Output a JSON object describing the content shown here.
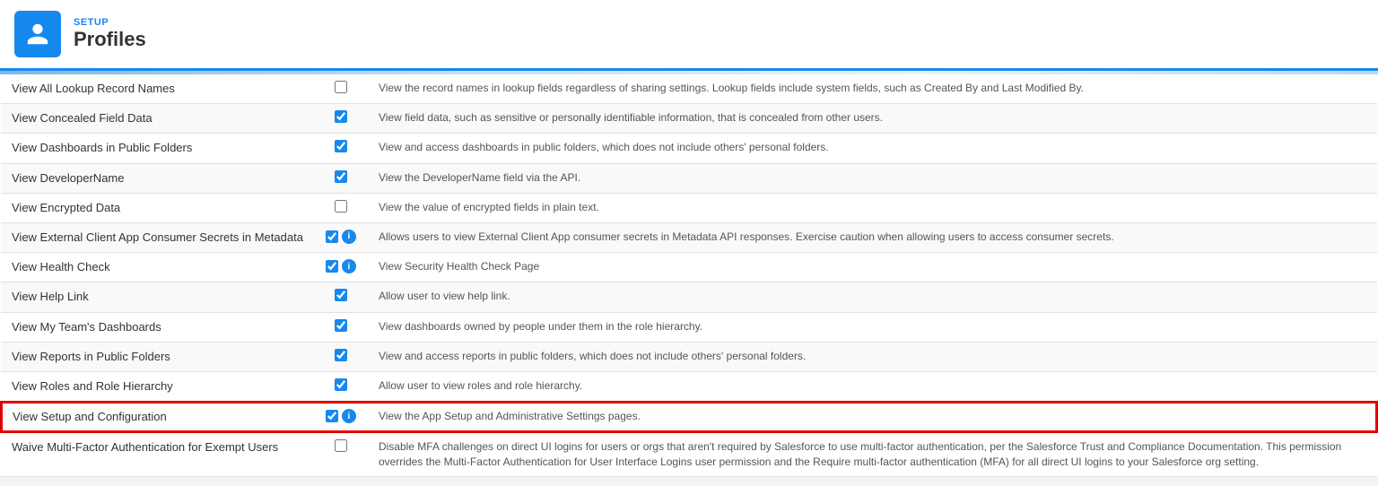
{
  "header": {
    "setup_label": "SETUP",
    "page_title": "Profiles"
  },
  "table": {
    "rows": [
      {
        "name": "View All Lookup Record Names",
        "checked": false,
        "has_info": false,
        "description": "View the record names in lookup fields regardless of sharing settings. Lookup fields include system fields, such as Created By and Last Modified By."
      },
      {
        "name": "View Concealed Field Data",
        "checked": true,
        "has_info": false,
        "description": "View field data, such as sensitive or personally identifiable information, that is concealed from other users."
      },
      {
        "name": "View Dashboards in Public Folders",
        "checked": true,
        "has_info": false,
        "description": "View and access dashboards in public folders, which does not include others' personal folders."
      },
      {
        "name": "View DeveloperName",
        "checked": true,
        "has_info": false,
        "description": "View the DeveloperName field via the API."
      },
      {
        "name": "View Encrypted Data",
        "checked": false,
        "has_info": false,
        "description": "View the value of encrypted fields in plain text."
      },
      {
        "name": "View External Client App Consumer Secrets in Metadata",
        "checked": true,
        "has_info": true,
        "description": "Allows users to view External Client App consumer secrets in Metadata API responses. Exercise caution when allowing users to access consumer secrets."
      },
      {
        "name": "View Health Check",
        "checked": true,
        "has_info": true,
        "description": "View Security Health Check Page"
      },
      {
        "name": "View Help Link",
        "checked": true,
        "has_info": false,
        "description": "Allow user to view help link."
      },
      {
        "name": "View My Team's Dashboards",
        "checked": true,
        "has_info": false,
        "description": "View dashboards owned by people under them in the role hierarchy."
      },
      {
        "name": "View Reports in Public Folders",
        "checked": true,
        "has_info": false,
        "description": "View and access reports in public folders, which does not include others' personal folders."
      },
      {
        "name": "View Roles and Role Hierarchy",
        "checked": true,
        "has_info": false,
        "description": "Allow user to view roles and role hierarchy."
      },
      {
        "name": "View Setup and Configuration",
        "checked": true,
        "has_info": true,
        "description": "View the App Setup and Administrative Settings pages.",
        "highlighted": true
      },
      {
        "name": "Waive Multi-Factor Authentication for Exempt Users",
        "checked": false,
        "has_info": false,
        "description": "Disable MFA challenges on direct UI logins for users or orgs that aren't required by Salesforce to use multi-factor authentication, per the Salesforce Trust and Compliance Documentation. This permission overrides the Multi-Factor Authentication for User Interface Logins user permission and the Require multi-factor authentication (MFA) for all direct UI logins to your Salesforce org setting."
      }
    ]
  }
}
